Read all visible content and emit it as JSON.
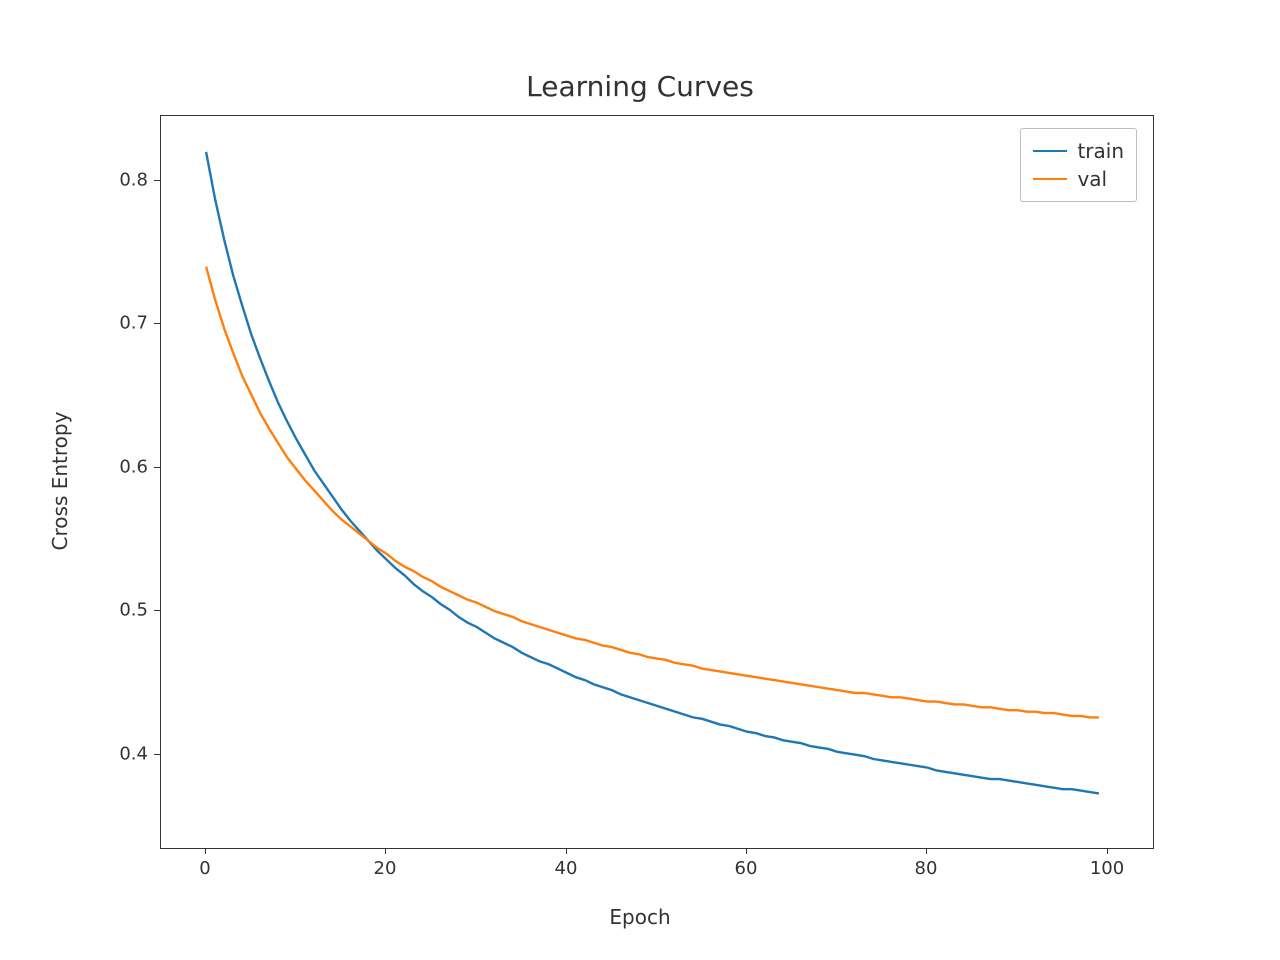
{
  "chart_data": {
    "type": "line",
    "title": "Learning Curves",
    "xlabel": "Epoch",
    "ylabel": "Cross Entropy",
    "xlim": [
      -5,
      105
    ],
    "ylim": [
      0.335,
      0.845
    ],
    "xticks": [
      0,
      20,
      40,
      60,
      80,
      100
    ],
    "yticks": [
      0.4,
      0.5,
      0.6,
      0.7,
      0.8
    ],
    "x": [
      0,
      1,
      2,
      3,
      4,
      5,
      6,
      7,
      8,
      9,
      10,
      11,
      12,
      13,
      14,
      15,
      16,
      17,
      18,
      19,
      20,
      21,
      22,
      23,
      24,
      25,
      26,
      27,
      28,
      29,
      30,
      31,
      32,
      33,
      34,
      35,
      36,
      37,
      38,
      39,
      40,
      41,
      42,
      43,
      44,
      45,
      46,
      47,
      48,
      49,
      50,
      51,
      52,
      53,
      54,
      55,
      56,
      57,
      58,
      59,
      60,
      61,
      62,
      63,
      64,
      65,
      66,
      67,
      68,
      69,
      70,
      71,
      72,
      73,
      74,
      75,
      76,
      77,
      78,
      79,
      80,
      81,
      82,
      83,
      84,
      85,
      86,
      87,
      88,
      89,
      90,
      91,
      92,
      93,
      94,
      95,
      96,
      97,
      98,
      99
    ],
    "series": [
      {
        "name": "train",
        "color": "#1f77b4",
        "values": [
          0.82,
          0.787,
          0.759,
          0.734,
          0.713,
          0.693,
          0.676,
          0.66,
          0.645,
          0.632,
          0.62,
          0.609,
          0.598,
          0.589,
          0.58,
          0.571,
          0.563,
          0.556,
          0.549,
          0.542,
          0.536,
          0.53,
          0.525,
          0.519,
          0.514,
          0.51,
          0.505,
          0.501,
          0.496,
          0.492,
          0.489,
          0.485,
          0.481,
          0.478,
          0.475,
          0.471,
          0.468,
          0.465,
          0.463,
          0.46,
          0.457,
          0.454,
          0.452,
          0.449,
          0.447,
          0.445,
          0.442,
          0.44,
          0.438,
          0.436,
          0.434,
          0.432,
          0.43,
          0.428,
          0.426,
          0.425,
          0.423,
          0.421,
          0.42,
          0.418,
          0.416,
          0.415,
          0.413,
          0.412,
          0.41,
          0.409,
          0.408,
          0.406,
          0.405,
          0.404,
          0.402,
          0.401,
          0.4,
          0.399,
          0.397,
          0.396,
          0.395,
          0.394,
          0.393,
          0.392,
          0.391,
          0.389,
          0.388,
          0.387,
          0.386,
          0.385,
          0.384,
          0.383,
          0.383,
          0.382,
          0.381,
          0.38,
          0.379,
          0.378,
          0.377,
          0.376,
          0.376,
          0.375,
          0.374,
          0.373
        ]
      },
      {
        "name": "val",
        "color": "#ff7f0e",
        "values": [
          0.74,
          0.717,
          0.697,
          0.68,
          0.664,
          0.651,
          0.638,
          0.627,
          0.617,
          0.607,
          0.599,
          0.591,
          0.584,
          0.577,
          0.57,
          0.564,
          0.559,
          0.554,
          0.549,
          0.544,
          0.54,
          0.535,
          0.531,
          0.528,
          0.524,
          0.521,
          0.517,
          0.514,
          0.511,
          0.508,
          0.506,
          0.503,
          0.5,
          0.498,
          0.496,
          0.493,
          0.491,
          0.489,
          0.487,
          0.485,
          0.483,
          0.481,
          0.48,
          0.478,
          0.476,
          0.475,
          0.473,
          0.471,
          0.47,
          0.468,
          0.467,
          0.466,
          0.464,
          0.463,
          0.462,
          0.46,
          0.459,
          0.458,
          0.457,
          0.456,
          0.455,
          0.454,
          0.453,
          0.452,
          0.451,
          0.45,
          0.449,
          0.448,
          0.447,
          0.446,
          0.445,
          0.444,
          0.443,
          0.443,
          0.442,
          0.441,
          0.44,
          0.44,
          0.439,
          0.438,
          0.437,
          0.437,
          0.436,
          0.435,
          0.435,
          0.434,
          0.433,
          0.433,
          0.432,
          0.431,
          0.431,
          0.43,
          0.43,
          0.429,
          0.429,
          0.428,
          0.427,
          0.427,
          0.426,
          0.426
        ]
      }
    ],
    "legend": {
      "entries": [
        "train",
        "val"
      ],
      "position": "upper right"
    }
  }
}
